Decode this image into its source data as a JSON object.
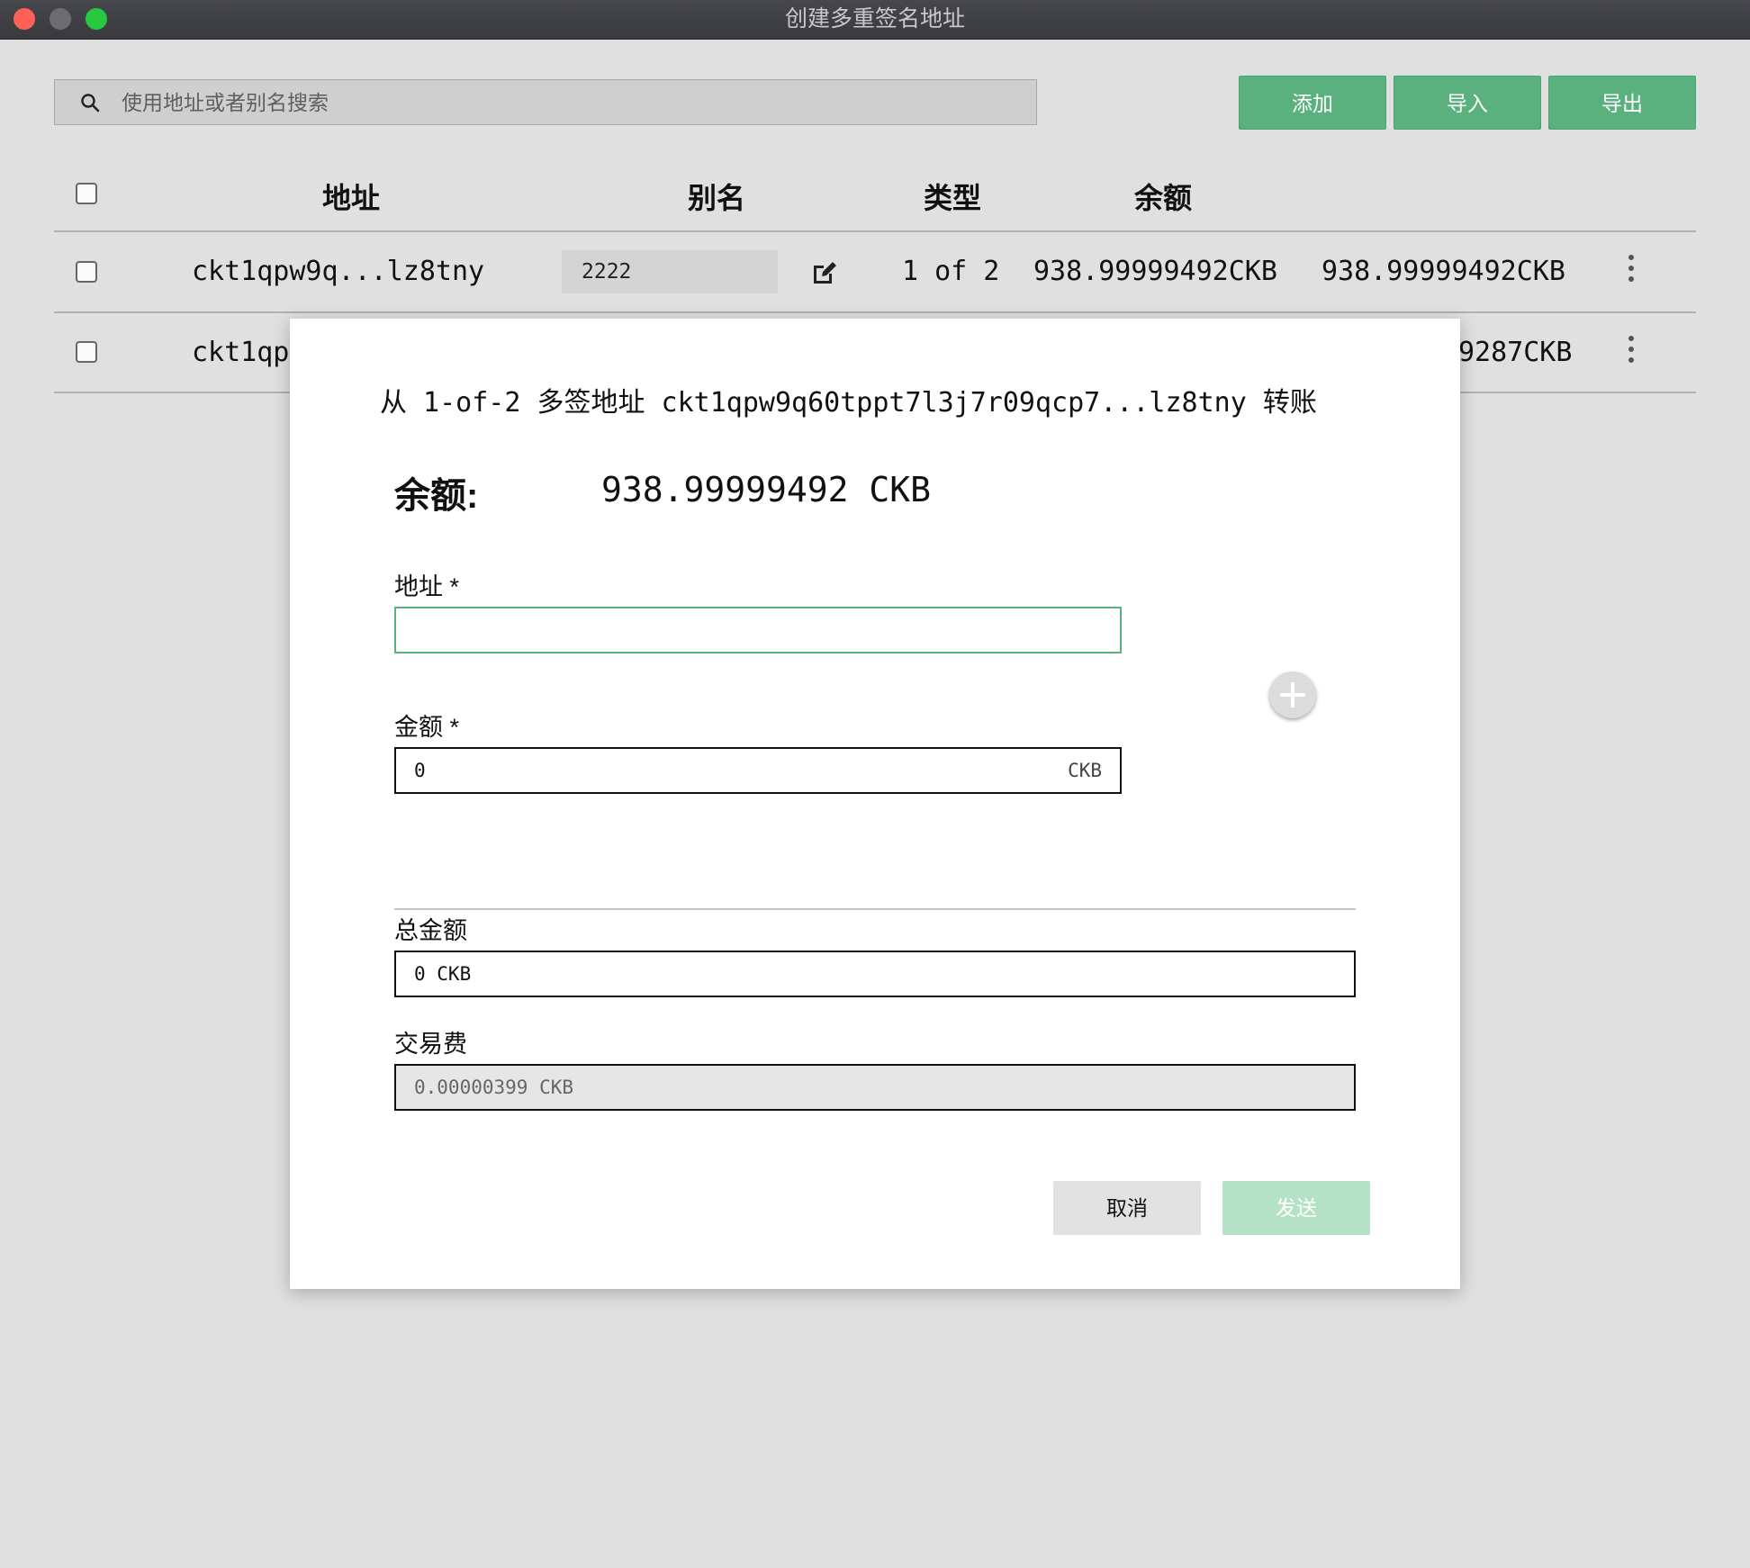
{
  "window": {
    "title": "创建多重签名地址"
  },
  "toolbar": {
    "search_placeholder": "使用地址或者别名搜索",
    "search_value": "",
    "add_label": "添加",
    "import_label": "导入",
    "export_label": "导出"
  },
  "table": {
    "headers": {
      "address": "地址",
      "alias": "别名",
      "type": "类型",
      "balance": "余额"
    },
    "rows": [
      {
        "checked": false,
        "address": "ckt1qpw9q...lz8tny",
        "alias": "2222",
        "type": "1 of 2",
        "balance": "938.99999492CKB",
        "balance2": "938.99999492CKB"
      },
      {
        "checked": false,
        "address": "ckt1qp",
        "balance2": "9287CKB"
      }
    ]
  },
  "dialog": {
    "title": "从 1-of-2 多签地址 ckt1qpw9q60tppt7l3j7r09qcp7...lz8tny 转账",
    "balance_label": "余额:",
    "balance_value": "938.99999492 CKB",
    "address_label": "地址 *",
    "address_value": "",
    "amount_label": "金额 *",
    "amount_value": "0",
    "amount_unit": "CKB",
    "total_label": "总金额",
    "total_value": "0 CKB",
    "fee_label": "交易费",
    "fee_value": "0.00000399 CKB",
    "cancel_label": "取消",
    "send_label": "发送"
  },
  "colors": {
    "accent": "#5bb17d",
    "accent_disabled": "#b3e2c6",
    "focus_border": "#5bb17d"
  }
}
